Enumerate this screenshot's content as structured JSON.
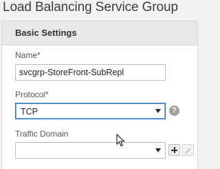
{
  "page": {
    "title": "Load Balancing Service Group"
  },
  "panel": {
    "title": "Basic Settings"
  },
  "form": {
    "name": {
      "label": "Name*",
      "value": "svcgrp-StoreFront-SubRepl"
    },
    "protocol": {
      "label": "Protocol*",
      "selected": "TCP",
      "help_icon": "?"
    },
    "traffic_domain": {
      "label": "Traffic Domain",
      "selected": ""
    }
  },
  "icons": {
    "help": "question-mark-circle",
    "add": "plus",
    "edit": "pencil",
    "cursor": "mouse-pointer"
  },
  "colors": {
    "focus_border": "#2f6fbf",
    "help_icon": "#a0a0a0"
  }
}
